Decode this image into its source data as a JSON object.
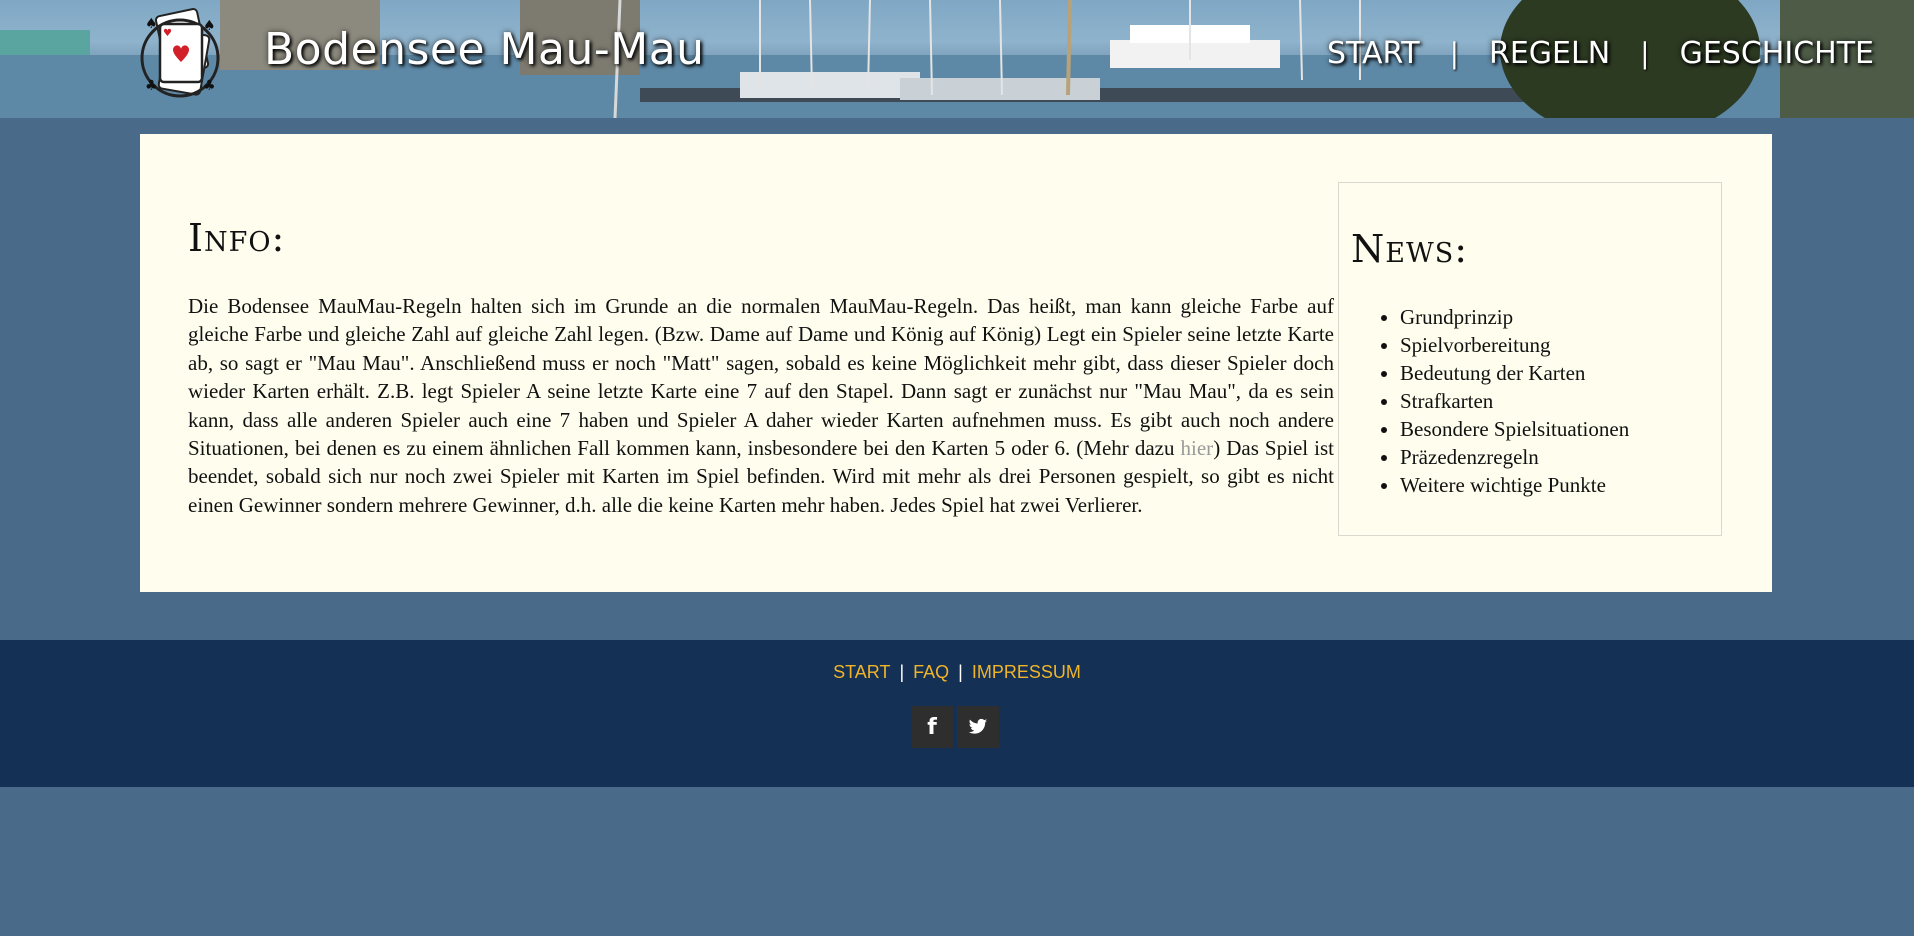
{
  "header": {
    "title": "Bodensee Mau-Mau",
    "nav": [
      {
        "label": "START"
      },
      {
        "label": "REGELN"
      },
      {
        "label": "GESCHICHTE"
      }
    ]
  },
  "info": {
    "heading": "Info:",
    "text_before_link": "Die Bodensee MauMau-Regeln halten sich im Grunde an die normalen MauMau-Regeln. Das heißt, man kann gleiche Farbe auf gleiche Farbe und gleiche Zahl auf gleiche Zahl legen. (Bzw. Dame auf Dame und König auf König) Legt ein Spieler seine letzte Karte ab, so sagt er \"Mau Mau\". Anschließend muss er noch \"Matt\" sagen, sobald es keine Möglichkeit mehr gibt, dass dieser Spieler doch wieder Karten erhält. Z.B. legt Spieler A seine letzte Karte eine 7 auf den Stapel. Dann sagt er zunächst nur \"Mau Mau\", da es sein kann, dass alle anderen Spieler auch eine 7 haben und Spieler A daher wieder Karten aufnehmen muss. Es gibt auch noch andere Situationen, bei denen es zu einem ähnlichen Fall kommen kann, insbesondere bei den Karten 5 oder 6. (Mehr dazu ",
    "link_label": "hier",
    "text_after_link": ") Das Spiel ist beendet, sobald sich nur noch zwei Spieler mit Karten im Spiel befinden. Wird mit mehr als drei Personen gespielt, so gibt es nicht einen Gewinner sondern mehrere Gewinner, d.h. alle die keine Karten mehr haben. Jedes Spiel hat zwei Verlierer."
  },
  "news": {
    "heading": "News:",
    "items": [
      "Grundprinzip",
      "Spielvorbereitung",
      "Bedeutung der Karten",
      "Strafkarten",
      "Besondere Spielsituationen",
      "Präzedenzregeln",
      "Weitere wichtige Punkte"
    ]
  },
  "footer": {
    "links": [
      "START",
      "FAQ",
      "IMPRESSUM"
    ],
    "separator": "|",
    "social": [
      {
        "icon": "facebook-icon",
        "glyph": "f"
      },
      {
        "icon": "twitter-icon"
      }
    ]
  },
  "colors": {
    "page_bg": "#4a6a8a",
    "panel_bg": "#fffeee",
    "footer_bg": "#143054",
    "footer_link": "#f0b428",
    "link_muted": "#999999"
  }
}
